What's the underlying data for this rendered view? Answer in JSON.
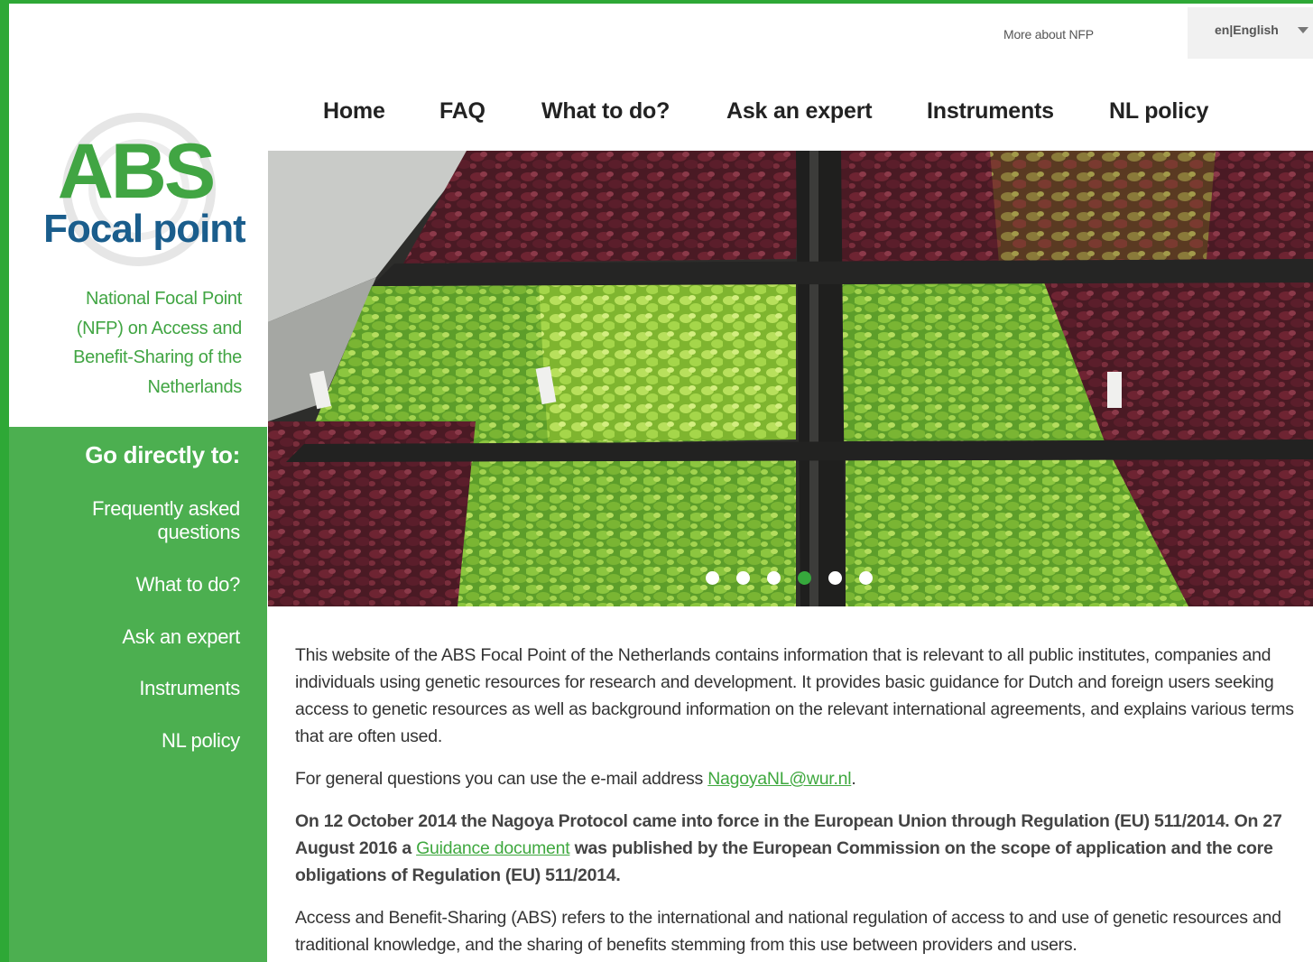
{
  "header": {
    "more_about": "More about NFP",
    "language": "en|English"
  },
  "logo": {
    "line1": "ABS",
    "line2": "Focal point"
  },
  "tagline": [
    "National Focal Point",
    "(NFP) on Access and",
    "Benefit-Sharing of the",
    "Netherlands"
  ],
  "nav": [
    "Home",
    "FAQ",
    "What to do?",
    "Ask an expert",
    "Instruments",
    "NL policy"
  ],
  "sidebar": {
    "title": "Go directly to:",
    "links": [
      "Frequently asked questions",
      "What to do?",
      "Ask an expert",
      "Instruments",
      "NL policy"
    ]
  },
  "slider": {
    "count": 6,
    "active_index": 3
  },
  "content": {
    "p1": "This website of the ABS Focal Point of the Netherlands contains information that is relevant to all public institutes, companies and individuals using genetic resources for research and development. It provides basic guidance for Dutch and foreign users seeking access to genetic resources as well as background information on the relevant international agreements, and explains various terms that are often used.",
    "p2_before": "For general questions you can use the e-mail address ",
    "p2_email": "NagoyaNL@wur.nl",
    "p2_after": ".",
    "p3_part1": "On 12 October 2014 the Nagoya Protocol came into force in the European Union through Regulation (EU) 511/2014. On 27 August 2016 a ",
    "p3_link": "Guidance document",
    "p3_part2": " was published by the European Commission on the scope of application and the core obligations of Regulation (EU) 511/2014.",
    "p4": "Access and Benefit-Sharing (ABS) refers to the international and national regulation of access to and use of genetic resources and traditional knowledge, and the sharing of benefits stemming from this use between providers and users."
  },
  "colors": {
    "brand_green": "#41a543",
    "sidebar_green": "#4caf50",
    "logo_blue": "#1a5d8c",
    "border_green": "#2ea836"
  }
}
